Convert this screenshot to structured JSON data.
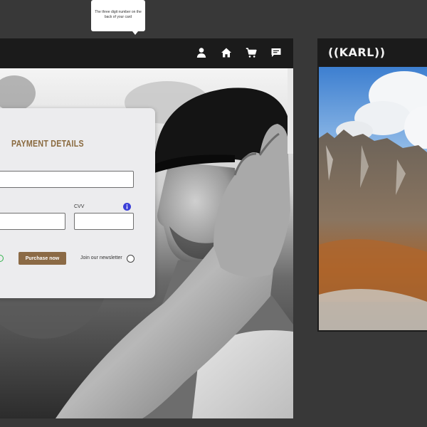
{
  "tooltip": {
    "text": "The three digit number on the back of your card"
  },
  "nav": {
    "icons": [
      "user-icon",
      "home-icon",
      "cart-icon",
      "chat-icon"
    ]
  },
  "payment": {
    "title": "PAYMENT DETAILS",
    "cvv_label": "CVV",
    "purchase_label": "Purchase now",
    "newsletter_label": "Join our newsletter"
  },
  "brand": {
    "name": "((KARL))"
  },
  "colors": {
    "background": "#383838",
    "frame": "#1b1b1b",
    "accent_brown": "#8b6a45",
    "title_brown": "#8a6a3f",
    "info_blue": "#3b3fd8",
    "radio_green": "#2fb24a"
  }
}
